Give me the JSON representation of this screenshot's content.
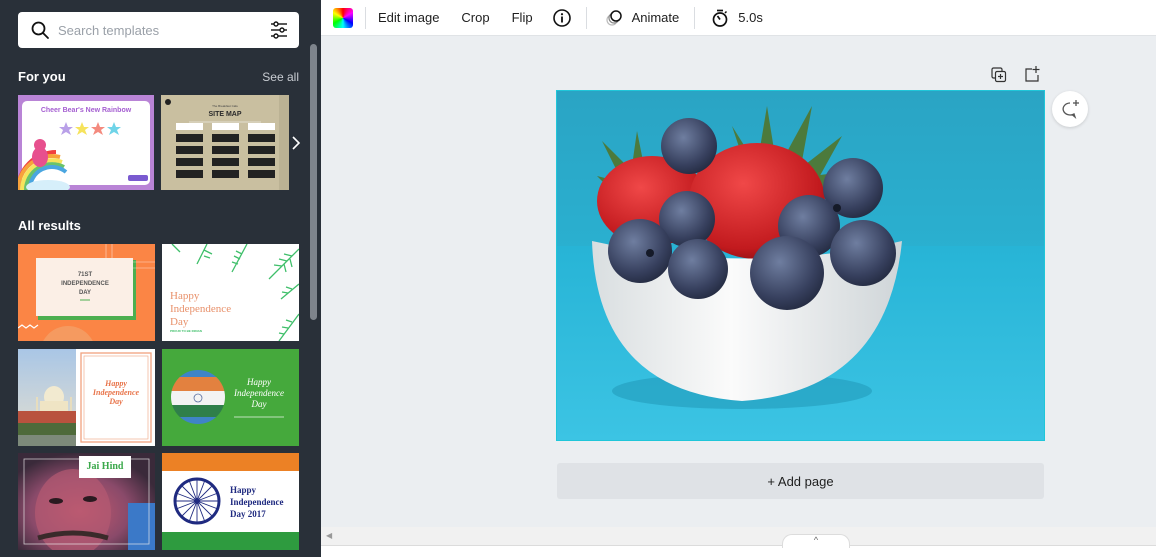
{
  "sidebar": {
    "search": {
      "placeholder": "Search templates",
      "value": ""
    },
    "for_you": {
      "title": "For you",
      "see_all": "See all",
      "templates": [
        {
          "title": "Cheer Bear's New Rainbow",
          "bg": "#b984d6"
        },
        {
          "title": "SITE MAP",
          "subtitle": "The Breakfast Cafe",
          "bg": "#c9bfa0"
        }
      ]
    },
    "all_results": {
      "title": "All results",
      "templates": [
        {
          "lines": [
            "71ST",
            "INDEPENDENCE",
            "DAY"
          ],
          "bg": "#fb8545"
        },
        {
          "lines": [
            "Happy",
            "Independence",
            "Day"
          ],
          "caption": "PROUD TO BE INDIAN",
          "bg": "#ffffff"
        },
        {
          "lines": [
            "Happy",
            "Independence",
            "Day"
          ],
          "bg": "#ffffff"
        },
        {
          "lines": [
            "Happy",
            "Independence",
            "Day"
          ],
          "bg": "#45a93c"
        },
        {
          "lines": [
            "Jai Hind"
          ],
          "bg": "#8a4a6a"
        },
        {
          "lines": [
            "Happy",
            "Independence",
            "Day 2017"
          ],
          "bg": "#ffffff"
        }
      ]
    }
  },
  "toolbar": {
    "edit_image": "Edit image",
    "crop": "Crop",
    "flip": "Flip",
    "animate": "Animate",
    "duration": "5.0s"
  },
  "canvas": {
    "image_alt": "Bowl of strawberries and blueberries on blue background",
    "add_page": "+ Add page"
  },
  "colors": {
    "sidebar_bg": "#293039",
    "canvas_bg": "#ebeef1",
    "selection": "#1fc6d9"
  }
}
